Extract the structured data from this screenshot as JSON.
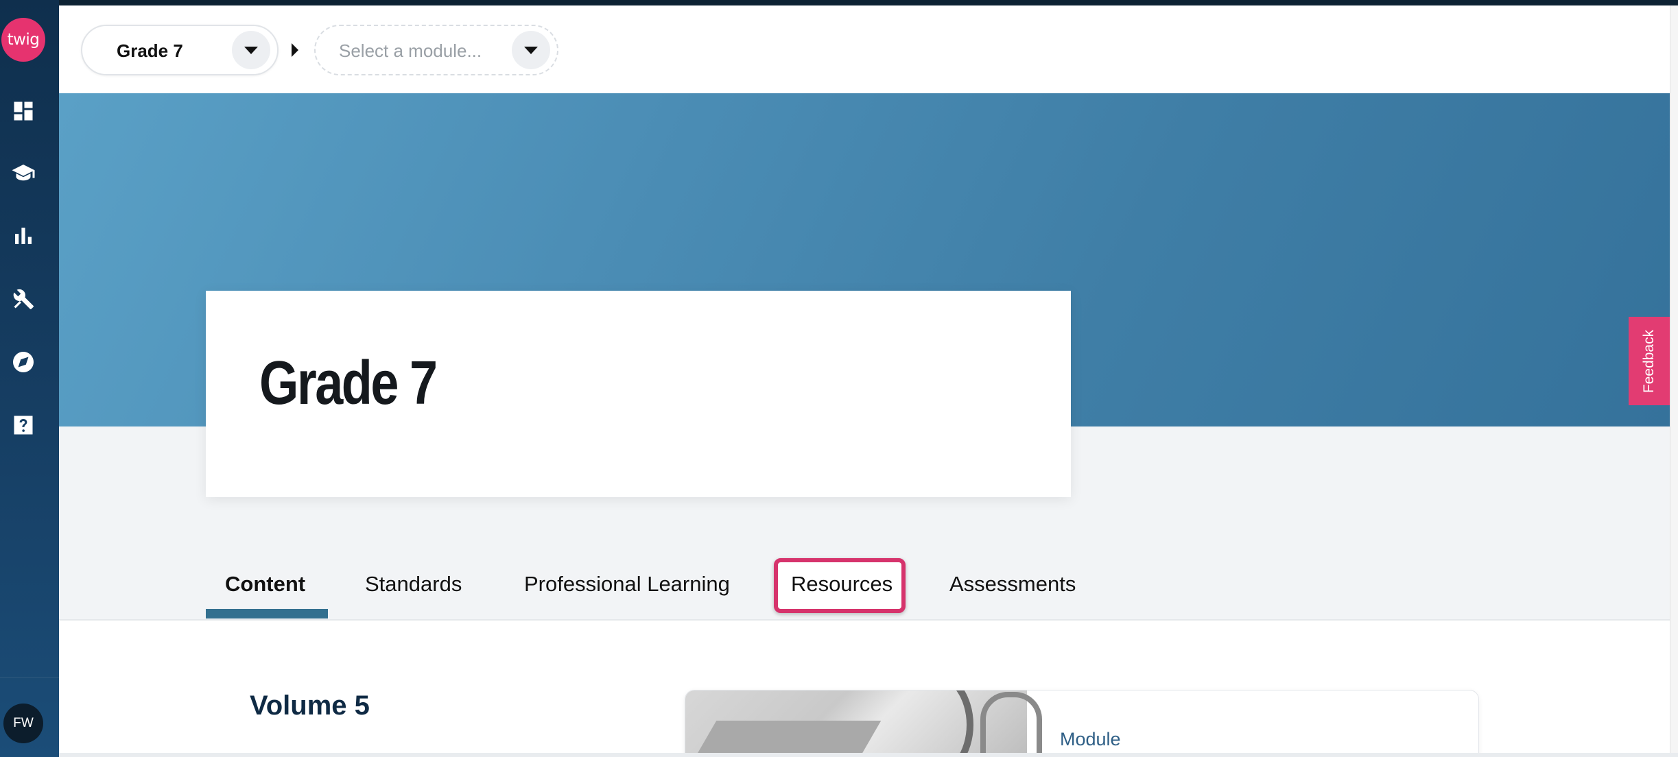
{
  "sidebar": {
    "logo_text": "twig",
    "items": [
      {
        "name": "dashboard",
        "icon": "dashboard-icon"
      },
      {
        "name": "courses",
        "icon": "graduation-cap-icon"
      },
      {
        "name": "reports",
        "icon": "bar-chart-icon"
      },
      {
        "name": "tools",
        "icon": "tools-icon"
      },
      {
        "name": "explore",
        "icon": "compass-icon"
      },
      {
        "name": "help",
        "icon": "help-icon"
      }
    ],
    "avatar_initials": "FW"
  },
  "breadcrumb": {
    "grade_value": "Grade 7",
    "module_placeholder": "Select a module..."
  },
  "hero": {
    "title": "Grade 7"
  },
  "feedback_label": "Feedback",
  "tabs": [
    {
      "label": "Content",
      "active": true
    },
    {
      "label": "Standards",
      "active": false
    },
    {
      "label": "Professional Learning",
      "active": false
    },
    {
      "label": "Resources",
      "active": false,
      "highlighted": true
    },
    {
      "label": "Assessments",
      "active": false
    }
  ],
  "content": {
    "volume_title": "Volume 5",
    "module_card_label": "Module"
  },
  "colors": {
    "sidebar": "#163e63",
    "brand_pink": "#e6336f",
    "hero_blue": "#4b8db5",
    "tab_underline": "#33708f",
    "highlight": "#d6336c"
  }
}
